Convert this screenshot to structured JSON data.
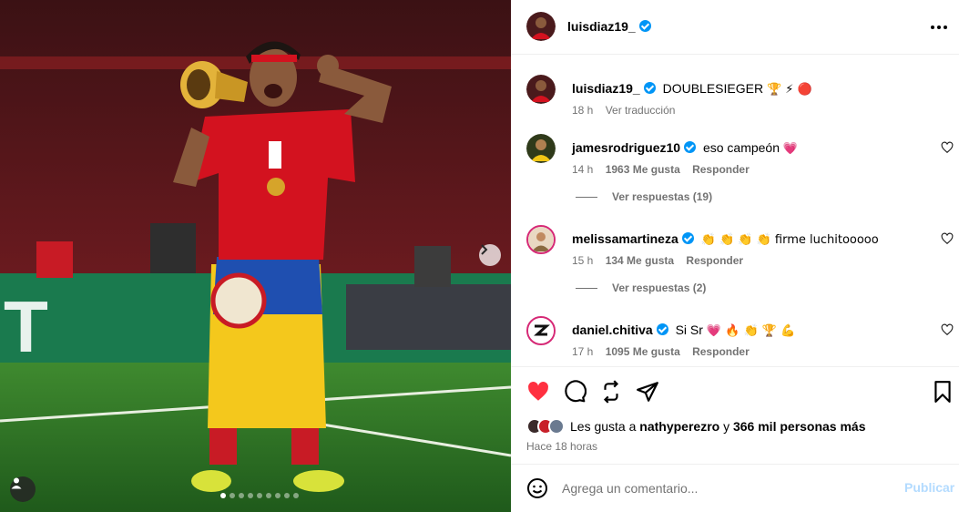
{
  "post": {
    "author": "luisdiaz19_",
    "caption": "DOUBLESIEGER",
    "caption_emoji": "🏆 ⚡ 🔴",
    "caption_time": "18 h",
    "translate_label": "Ver traducción",
    "photo_dot_count": 9,
    "photo_active_dot": 0
  },
  "comments": [
    {
      "user": "jamesrodriguez10",
      "verified": true,
      "text": "eso campeón",
      "emoji": "💗",
      "time": "14 h",
      "likes": "1963 Me gusta",
      "reply_label": "Responder",
      "view_replies": "Ver respuestas (19)"
    },
    {
      "user": "melissamartineza",
      "verified": true,
      "text": "👏 👏 👏 👏 firme luchitooooo",
      "emoji": "",
      "time": "15 h",
      "likes": "134 Me gusta",
      "reply_label": "Responder",
      "view_replies": "Ver respuestas (2)"
    },
    {
      "user": "daniel.chitiva",
      "verified": true,
      "text": "Si Sr",
      "emoji": "💗 🔥 👏 🏆 💪",
      "time": "17 h",
      "likes": "1095 Me gusta",
      "reply_label": "Responder",
      "view_replies": ""
    }
  ],
  "likes_bar": {
    "prefix": "Les gusta a",
    "user": "nathyperezro",
    "connector": "y",
    "others": "366 mil personas más",
    "time_ago": "Hace 18 horas"
  },
  "composer": {
    "placeholder": "Agrega un comentario...",
    "submit_label": "Publicar"
  },
  "colors": {
    "verified": "#0095f6",
    "like_red": "#ff3040",
    "muted": "#737373",
    "post_disabled": "#b3dbff"
  }
}
